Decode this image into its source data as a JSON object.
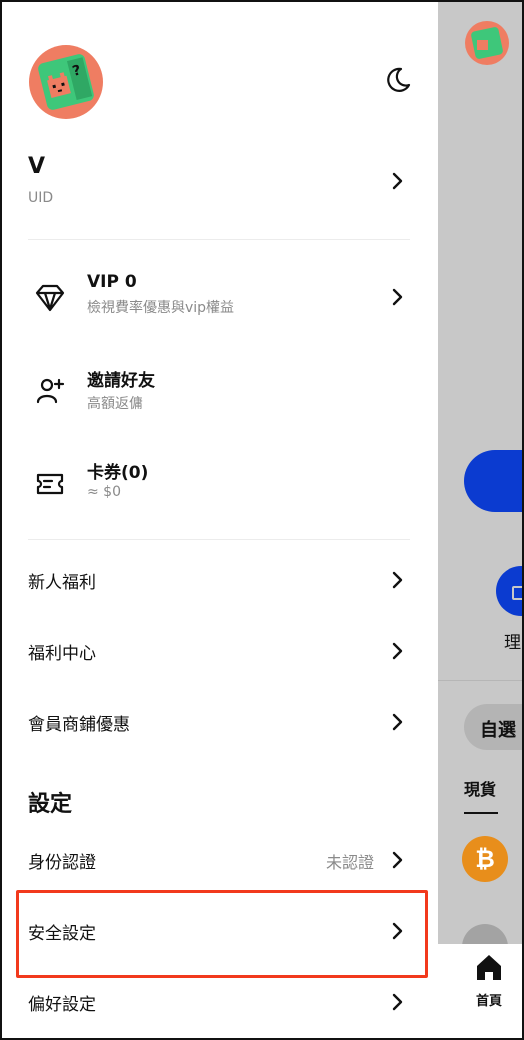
{
  "drawer": {
    "user": {
      "name": "V",
      "uid_label": "UID"
    },
    "features": [
      {
        "title": "VIP 0",
        "subtitle": "檢視費率優惠與vip權益",
        "icon": "diamond-icon"
      },
      {
        "title": "邀請好友",
        "subtitle": "高額返傭",
        "icon": "add-user-icon"
      },
      {
        "title": "卡券(0)",
        "subtitle": "≈ $0",
        "icon": "ticket-icon"
      }
    ],
    "menu": [
      {
        "label": "新人福利"
      },
      {
        "label": "福利中心"
      },
      {
        "label": "會員商鋪優惠"
      }
    ],
    "settings": {
      "title": "設定",
      "items": [
        {
          "label": "身份認證",
          "status": "未認證"
        },
        {
          "label": "安全設定"
        },
        {
          "label": "偏好設定"
        }
      ]
    }
  },
  "background": {
    "partial_label": "理",
    "chip_label": "自選",
    "tab_label": "現貨",
    "btc_symbol": "₿",
    "bottom_nav_home": "首頁"
  },
  "colors": {
    "accent_blue": "#0b3bd0",
    "highlight_red": "#f2391c",
    "btc_orange": "#e88e1b",
    "avatar_green": "#3ec77a",
    "avatar_salmon": "#ef7d62"
  }
}
